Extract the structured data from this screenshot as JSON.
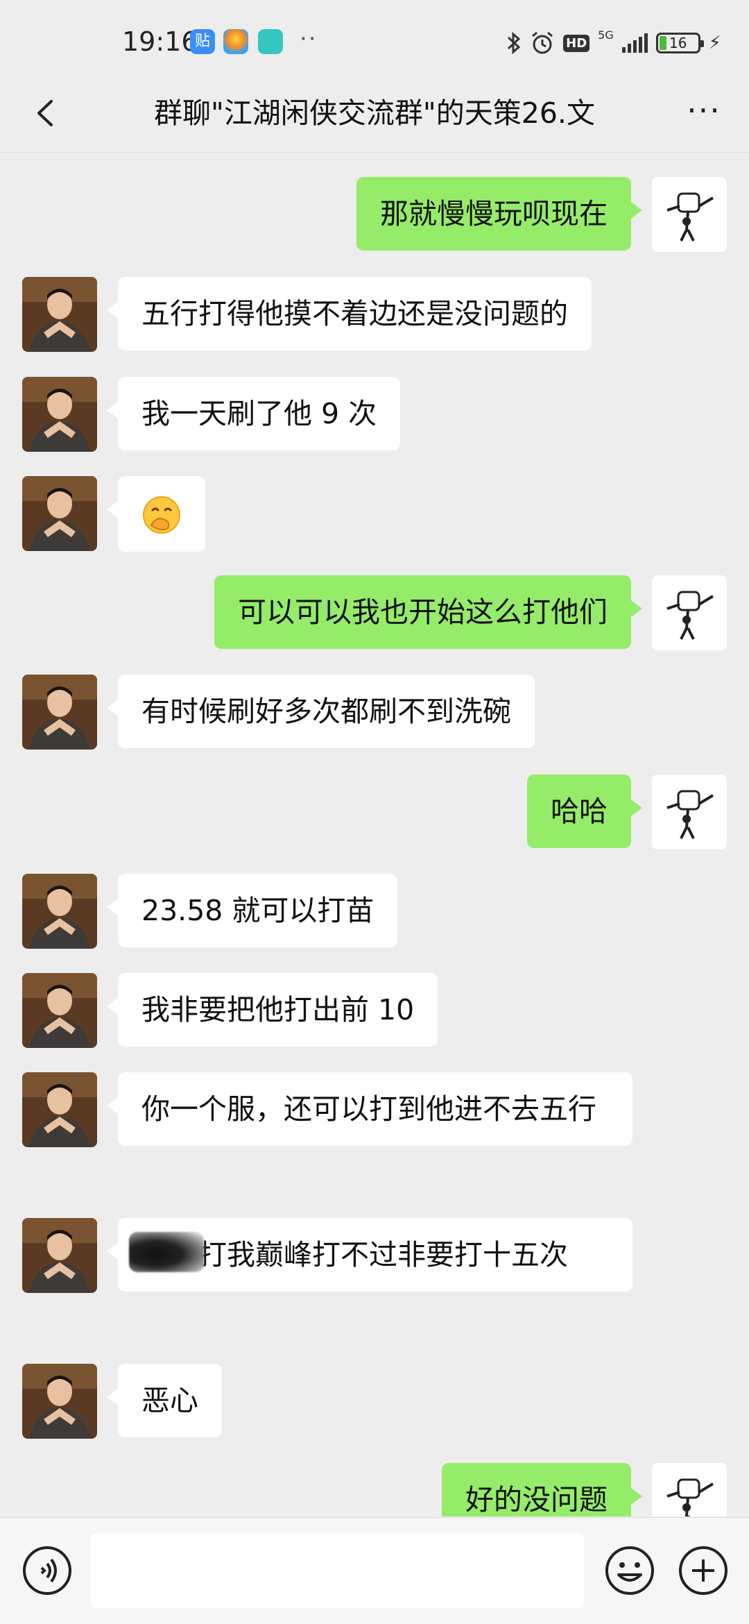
{
  "status": {
    "time": "19:16",
    "network": "5G",
    "hd": "HD",
    "battery": "16"
  },
  "header": {
    "title": "群聊\"江湖闲侠交流群\"的天策26.文"
  },
  "messages": [
    {
      "side": "right",
      "text": "那就慢慢玩呗现在"
    },
    {
      "side": "left",
      "text": "五行打得他摸不着边还是没问题的"
    },
    {
      "side": "left",
      "text": "我一天刷了他 9 次"
    },
    {
      "side": "left",
      "text": "",
      "emoji": "hand-over-mouth-emoji"
    },
    {
      "side": "right",
      "text": "可以可以我也开始这么打他们"
    },
    {
      "side": "left",
      "text": "有时候刷好多次都刷不到洗碗"
    },
    {
      "side": "right",
      "text": "哈哈"
    },
    {
      "side": "left",
      "text": "23.58 就可以打苗"
    },
    {
      "side": "left",
      "text": "我非要把他打出前 10"
    },
    {
      "side": "left",
      "text": "你一个服，还可以打到他进不去五行"
    },
    {
      "side": "left",
      "text": "为了打我巅峰打不过非要打十五次"
    },
    {
      "side": "left",
      "text": "恶心"
    },
    {
      "side": "right",
      "text": "好的没问题"
    }
  ],
  "input": {
    "placeholder": ""
  },
  "colors": {
    "background": "#ededed",
    "bubble_self": "#95ec69",
    "bubble_other": "#ffffff"
  }
}
